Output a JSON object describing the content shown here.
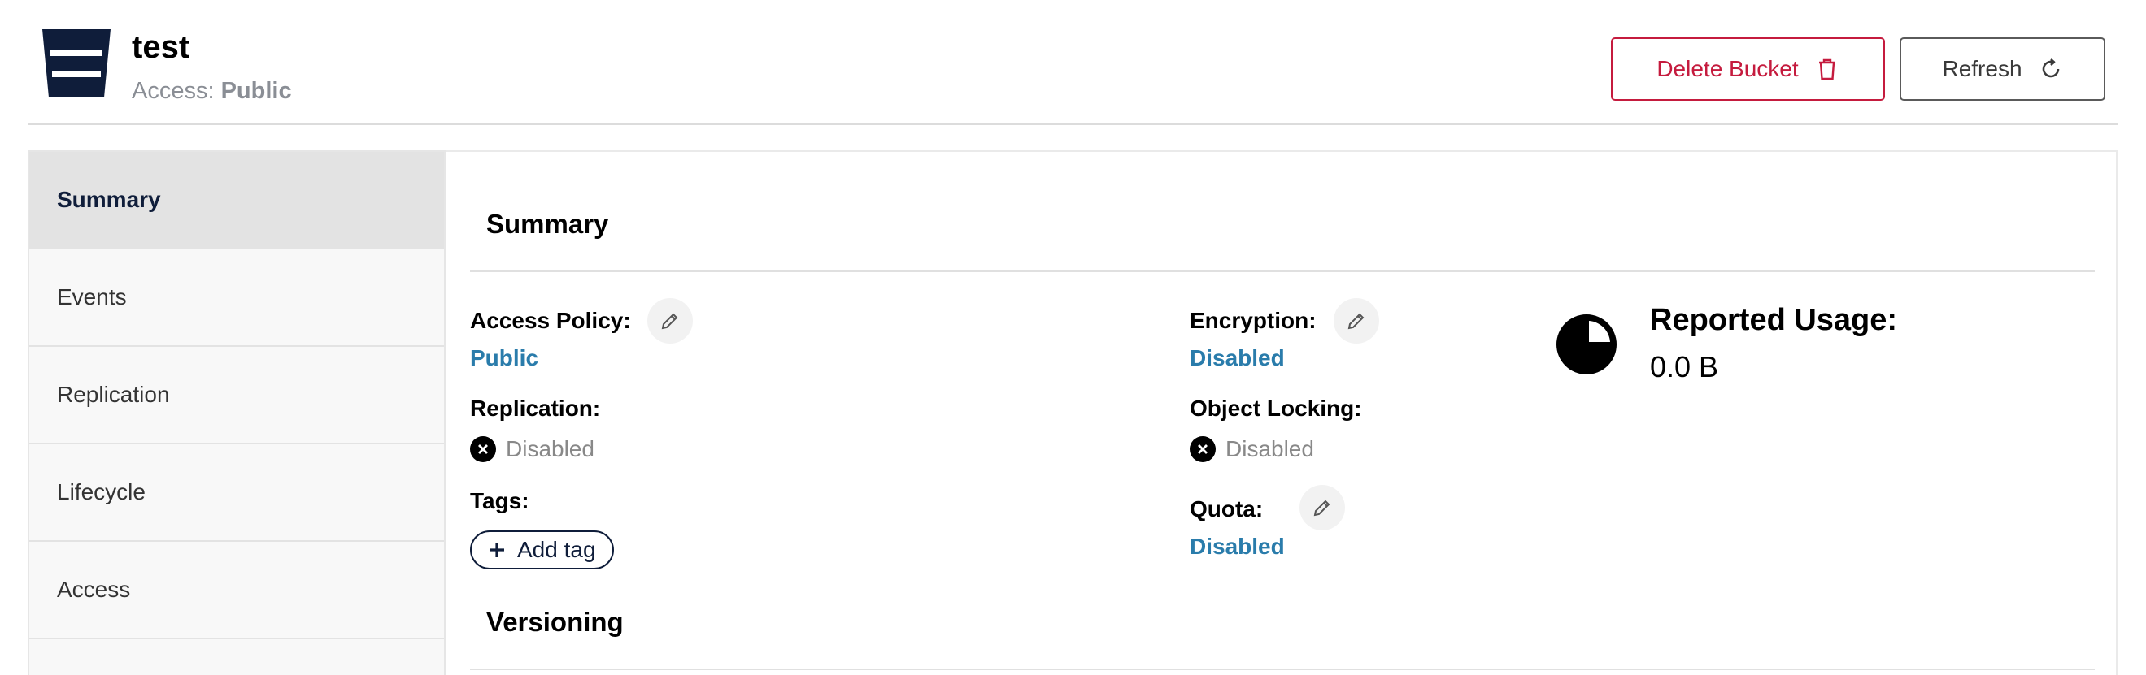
{
  "header": {
    "bucket_name": "test",
    "access_label": "Access:",
    "access_value": "Public",
    "delete_button": "Delete Bucket",
    "refresh_button": "Refresh",
    "bucket_icon": "bucket-icon",
    "delete_icon": "trash-icon",
    "refresh_icon": "refresh-icon"
  },
  "sidebar": {
    "items": [
      {
        "label": "Summary",
        "active": true
      },
      {
        "label": "Events",
        "active": false
      },
      {
        "label": "Replication",
        "active": false
      },
      {
        "label": "Lifecycle",
        "active": false
      },
      {
        "label": "Access",
        "active": false
      }
    ]
  },
  "summary": {
    "title": "Summary",
    "access_policy": {
      "label": "Access Policy:",
      "value": "Public"
    },
    "replication": {
      "label": "Replication:",
      "value": "Disabled"
    },
    "tags": {
      "label": "Tags:",
      "add_label": "Add tag"
    },
    "encryption": {
      "label": "Encryption:",
      "value": "Disabled"
    },
    "object_locking": {
      "label": "Object Locking:",
      "value": "Disabled"
    },
    "quota": {
      "label": "Quota:",
      "value": "Disabled"
    },
    "usage": {
      "label": "Reported Usage:",
      "value": "0.0 B"
    }
  },
  "versioning": {
    "title": "Versioning"
  },
  "colors": {
    "brand_navy": "#0f1d3a",
    "danger": "#c51b3e",
    "link_blue": "#2a7cab",
    "muted": "#888888"
  }
}
